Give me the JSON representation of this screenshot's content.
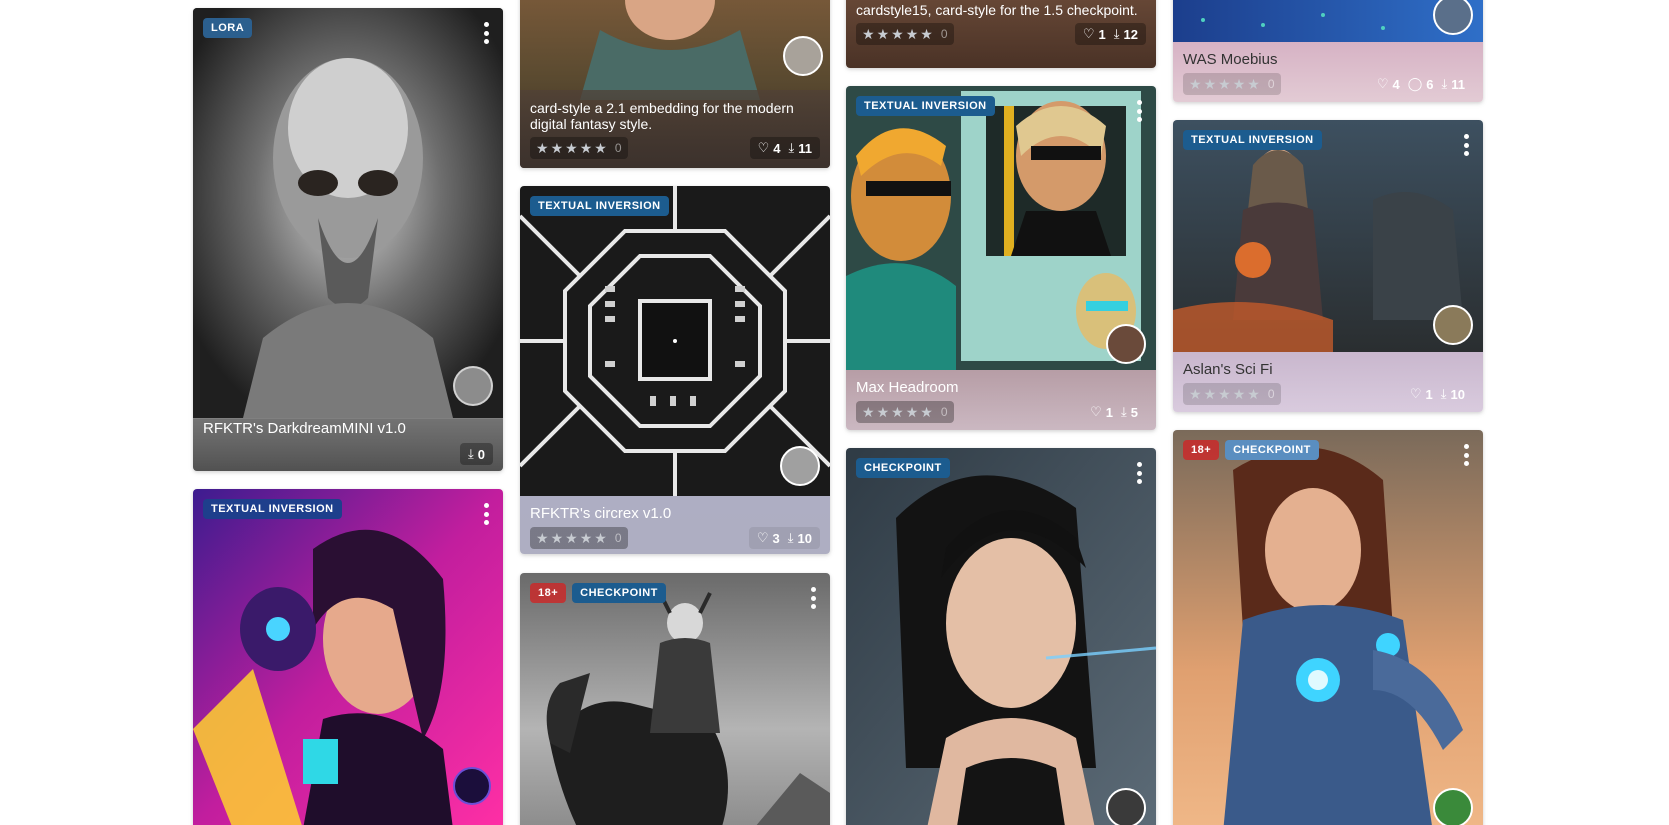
{
  "cards": {
    "c1": {
      "badge": "LORA",
      "title": "RFKTR's DarkdreamMINI v1.0",
      "downloads": "0"
    },
    "c2": {
      "badge": "TEXTUAL INVERSION"
    },
    "c3": {
      "title": "card-style a 2.1 embedding for the modern digital fantasy style.",
      "rating_count": "0",
      "likes": "4",
      "downloads": "11"
    },
    "c4": {
      "badge": "TEXTUAL INVERSION",
      "title": "RFKTR's circrex v1.0",
      "rating_count": "0",
      "likes": "3",
      "downloads": "10"
    },
    "c5": {
      "nsfw": "18+",
      "badge": "CHECKPOINT"
    },
    "c6": {
      "title": "cardstyle15, card-style for the 1.5 checkpoint.",
      "rating_count": "0",
      "likes": "1",
      "downloads": "12"
    },
    "c7": {
      "badge": "TEXTUAL INVERSION",
      "title": "Max Headroom",
      "rating_count": "0",
      "likes": "1",
      "downloads": "5"
    },
    "c8": {
      "badge": "CHECKPOINT"
    },
    "c9": {
      "title": "WAS Moebius",
      "rating_count": "0",
      "likes": "4",
      "comments": "6",
      "downloads": "11"
    },
    "c10": {
      "badge": "TEXTUAL INVERSION",
      "title": "Aslan's Sci Fi",
      "rating_count": "0",
      "likes": "1",
      "downloads": "10"
    },
    "c11": {
      "nsfw": "18+",
      "badge": "CHECKPOINT"
    }
  },
  "icons": {
    "star": "★",
    "heart": "♡",
    "comment": "◯",
    "download": "⤓"
  }
}
